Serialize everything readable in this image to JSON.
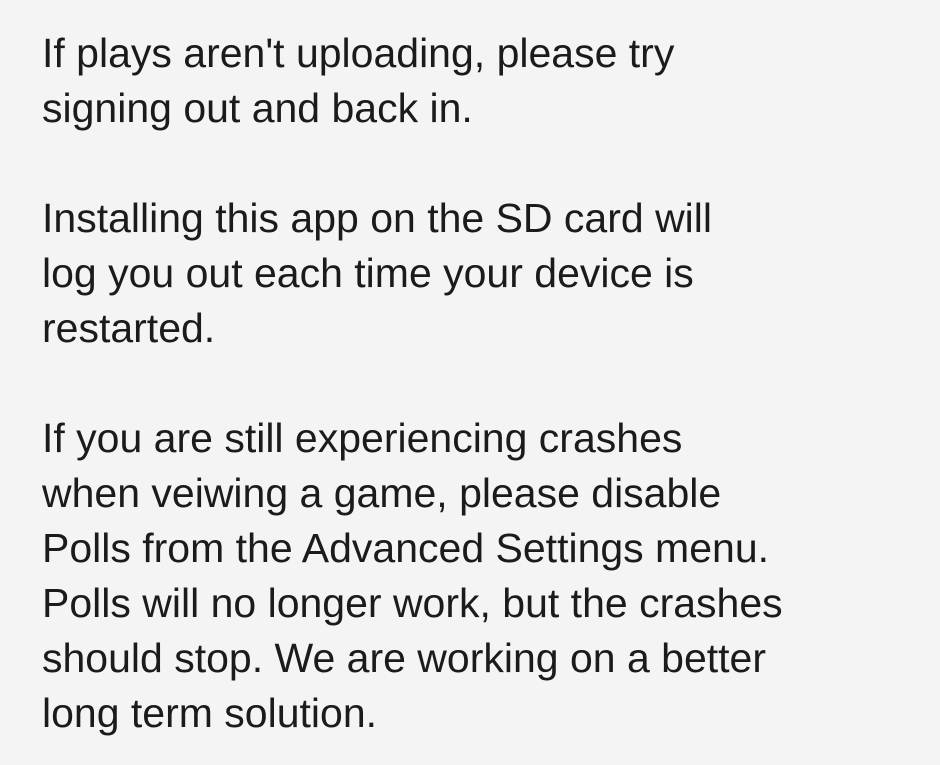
{
  "notice": {
    "paragraphs": [
      "If plays aren't uploading, please try\nsigning out and back in.",
      "Installing this app on the SD card will\nlog you out each time your device is\nrestarted.",
      "If you are still experiencing crashes\nwhen veiwing a game, please disable\nPolls from the Advanced Settings menu.\nPolls will no longer work, but the crashes\nshould stop. We are working on a better\nlong term solution."
    ]
  }
}
